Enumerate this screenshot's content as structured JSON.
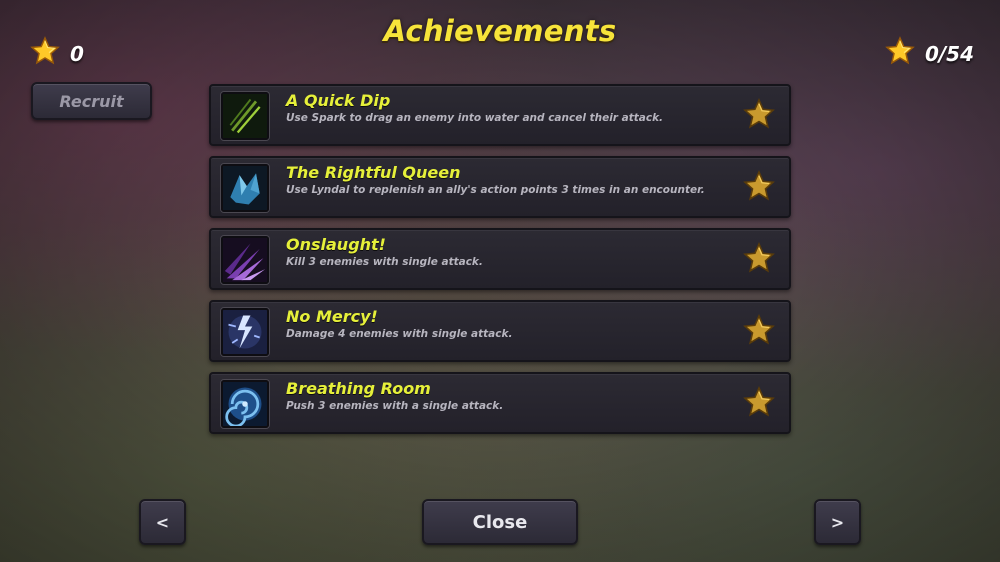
{
  "header": {
    "title": "Achievements"
  },
  "stats": {
    "left_value": "0",
    "right_value": "0/54"
  },
  "buttons": {
    "recruit": "Recruit",
    "prev": "<",
    "next": ">",
    "close": "Close"
  },
  "achievements": [
    {
      "title": "A Quick Dip",
      "description": "Use Spark to drag an enemy into water and cancel their attack.",
      "icon": "green-slash-icon"
    },
    {
      "title": "The Rightful Queen",
      "description": "Use Lyndal to replenish an ally's action points 3 times in an encounter.",
      "icon": "blue-crystal-icon"
    },
    {
      "title": "Onslaught!",
      "description": "Kill 3 enemies with single attack.",
      "icon": "purple-spikes-icon"
    },
    {
      "title": "No Mercy!",
      "description": "Damage 4 enemies with single attack.",
      "icon": "lightning-strike-icon"
    },
    {
      "title": "Breathing Room",
      "description": "Push 3 enemies with a single attack.",
      "icon": "blue-vortex-icon"
    }
  ],
  "colors": {
    "title": "#f7e43a",
    "achievement_title": "#e6f03a",
    "star_locked": "#c9a236",
    "star_top": "#ffd23a"
  }
}
